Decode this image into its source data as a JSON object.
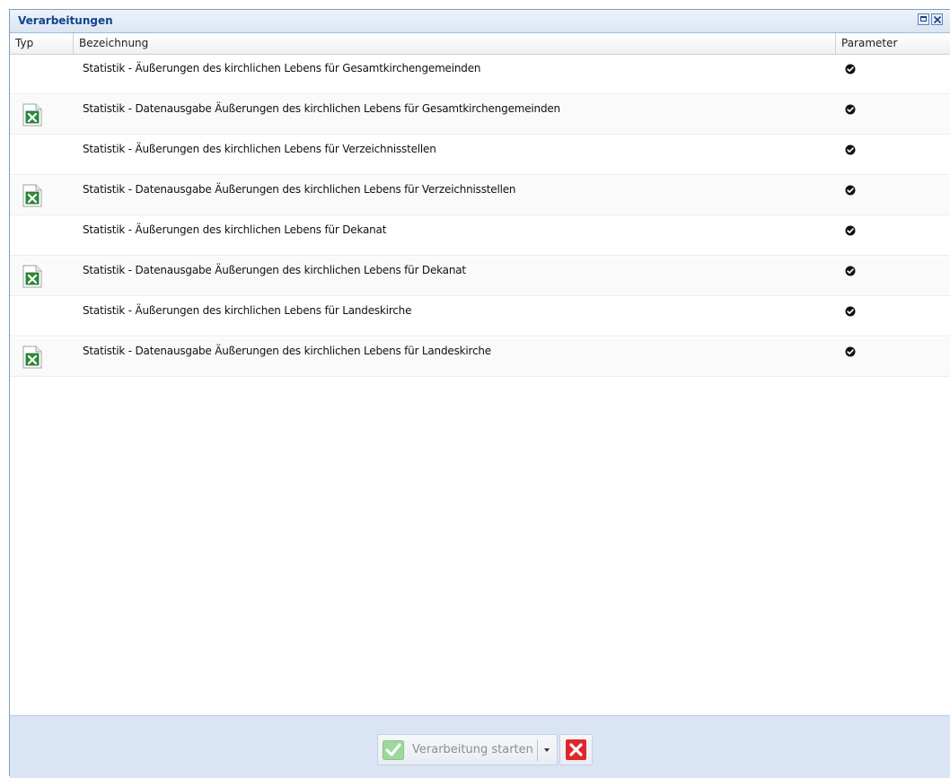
{
  "window": {
    "title": "Verarbeitungen"
  },
  "grid": {
    "columns": {
      "typ": "Typ",
      "bezeichnung": "Bezeichnung",
      "parameter": "Parameter"
    },
    "rows": [
      {
        "has_excel_icon": false,
        "bezeichnung": "Statistik - Äußerungen des kirchlichen Lebens für Gesamtkirchengemeinden",
        "parameter_icon": "check-circle-icon"
      },
      {
        "has_excel_icon": true,
        "bezeichnung": "Statistik - Datenausgabe Äußerungen des kirchlichen Lebens für Gesamtkirchengemeinden",
        "parameter_icon": "check-circle-icon"
      },
      {
        "has_excel_icon": false,
        "bezeichnung": "Statistik - Äußerungen des kirchlichen Lebens für Verzeichnisstellen",
        "parameter_icon": "check-circle-icon"
      },
      {
        "has_excel_icon": true,
        "bezeichnung": "Statistik - Datenausgabe Äußerungen des kirchlichen Lebens für Verzeichnisstellen",
        "parameter_icon": "check-circle-icon"
      },
      {
        "has_excel_icon": false,
        "bezeichnung": "Statistik - Äußerungen des kirchlichen Lebens für Dekanat",
        "parameter_icon": "check-circle-icon"
      },
      {
        "has_excel_icon": true,
        "bezeichnung": "Statistik - Datenausgabe Äußerungen des kirchlichen Lebens für Dekanat",
        "parameter_icon": "check-circle-icon"
      },
      {
        "has_excel_icon": false,
        "bezeichnung": "Statistik - Äußerungen des kirchlichen Lebens für Landeskirche",
        "parameter_icon": "check-circle-icon"
      },
      {
        "has_excel_icon": true,
        "bezeichnung": "Statistik - Datenausgabe Äußerungen des kirchlichen Lebens für Landeskirche",
        "parameter_icon": "check-circle-icon"
      }
    ]
  },
  "footer": {
    "start_label": "Verarbeitung starten",
    "start_enabled": false
  },
  "colors": {
    "title_text": "#15428b",
    "footer_bg": "#d9e5f4",
    "excel_green": "#1e7e34",
    "cancel_red": "#e0262b",
    "start_check": "#7dc67d"
  }
}
